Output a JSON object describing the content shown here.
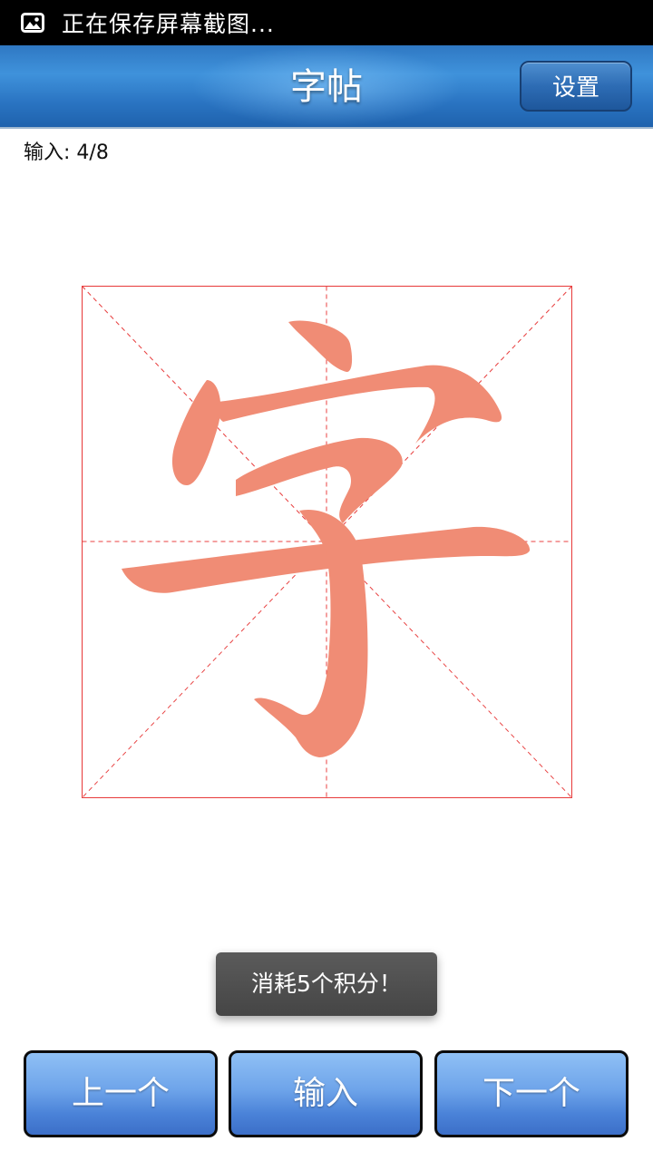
{
  "status_bar": {
    "icon": "image-icon",
    "text": "正在保存屏幕截图..."
  },
  "header": {
    "title": "字帖",
    "settings_label": "设置"
  },
  "progress": {
    "text": "输入: 4/8"
  },
  "practice": {
    "character": "字",
    "character_color": "#F08C75",
    "grid_color": "#E84040"
  },
  "toast": {
    "text": "消耗5个积分！"
  },
  "buttons": {
    "prev_label": "上一个",
    "input_label": "输入",
    "next_label": "下一个"
  },
  "colors": {
    "header_blue": "#2F78C3",
    "button_blue": "#6EA4EA"
  }
}
